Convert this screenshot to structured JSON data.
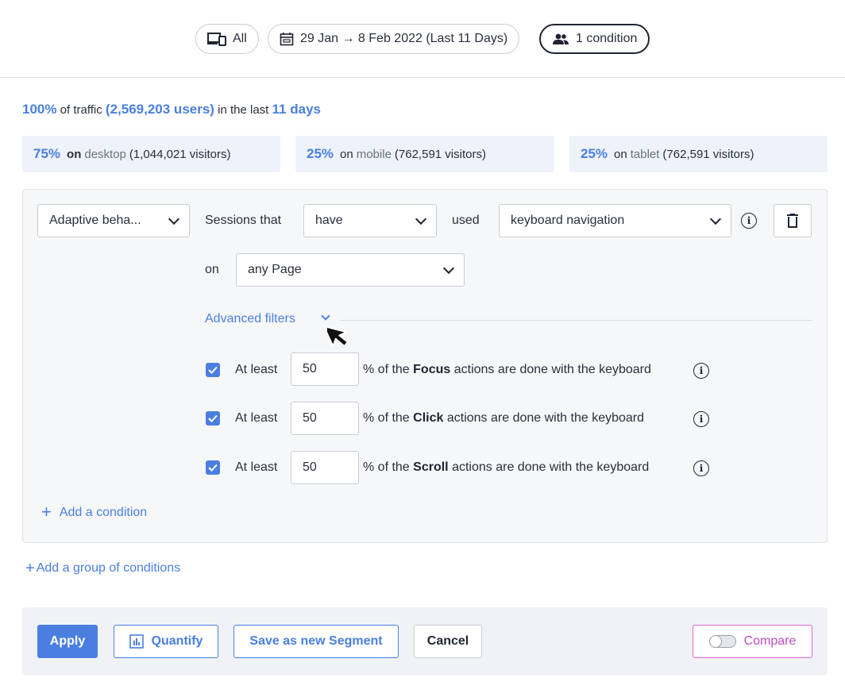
{
  "filters": {
    "device_label": "All",
    "date_label": "29 Jan → 8 Feb 2022 (Last 11 Days)",
    "condition_label": "1 condition"
  },
  "summary": {
    "traffic_pct": "100%",
    "of_traffic": "of traffic",
    "users": "(2,569,203 users)",
    "in_the_last": "in the last",
    "days": "11 days"
  },
  "stats": [
    {
      "pct": "75%",
      "on": "on",
      "device": "desktop",
      "visitors": "(1,044,021 visitors)"
    },
    {
      "pct": "25%",
      "on": "on",
      "device": "mobile",
      "visitors": "(762,591 visitors)"
    },
    {
      "pct": "25%",
      "on": "on",
      "device": "tablet",
      "visitors": "(762,591 visitors)"
    }
  ],
  "condition": {
    "category": "Adaptive beha...",
    "sessions_that": "Sessions that",
    "verb": "have",
    "used": "used",
    "feature": "keyboard navigation",
    "on": "on",
    "page": "any Page",
    "advanced_filters": "Advanced filters"
  },
  "advanced": [
    {
      "at_least": "At least",
      "value": "50",
      "prefix": "% of the",
      "action": "Focus",
      "suffix": "actions are done with the keyboard",
      "checked": true
    },
    {
      "at_least": "At least",
      "value": "50",
      "prefix": "% of the",
      "action": "Click",
      "suffix": "actions are done with the keyboard",
      "checked": true
    },
    {
      "at_least": "At least",
      "value": "50",
      "prefix": "% of the",
      "action": "Scroll",
      "suffix": "actions are done with the keyboard",
      "checked": true
    }
  ],
  "actions": {
    "add_condition": "Add a condition",
    "add_group": "Add a group of conditions"
  },
  "footer": {
    "apply": "Apply",
    "quantify": "Quantify",
    "save_segment": "Save as new Segment",
    "cancel": "Cancel",
    "compare": "Compare"
  },
  "colors": {
    "accent": "#4a7fe0",
    "compare": "#c04fc0",
    "panel": "#f6f7f9",
    "stat_bg": "#edf2fb"
  }
}
